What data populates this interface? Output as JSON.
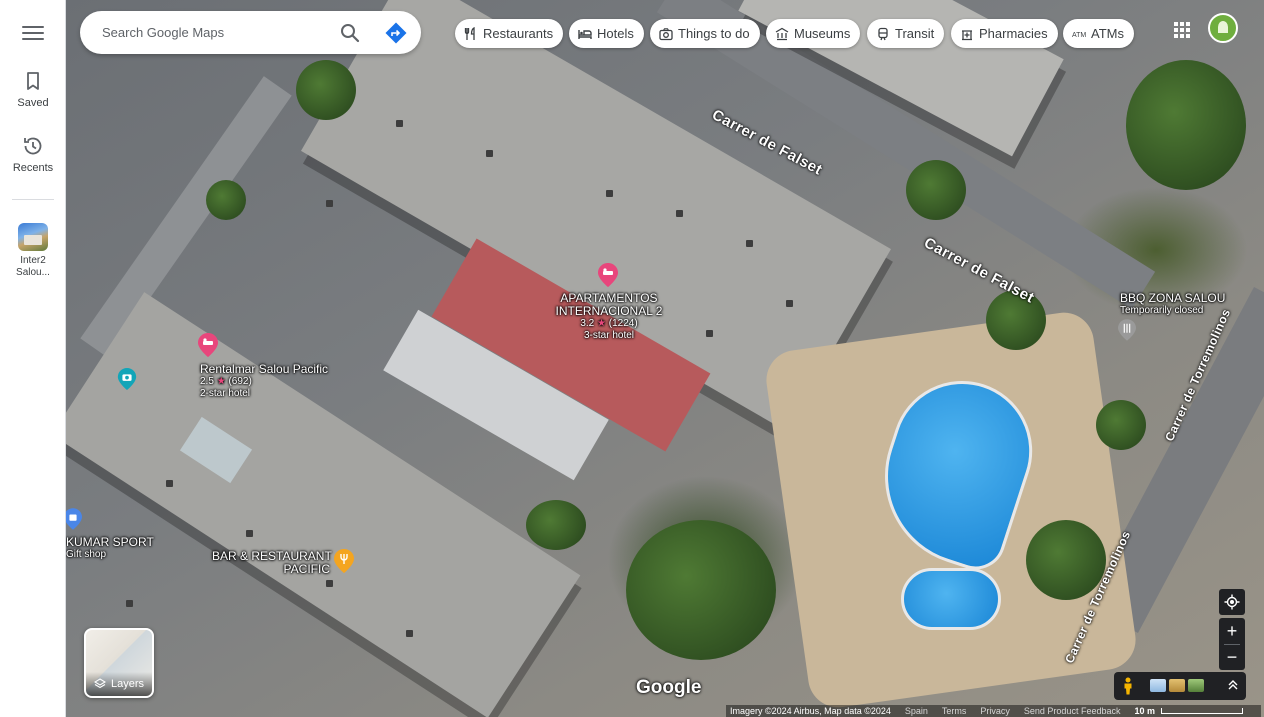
{
  "rail": {
    "saved_label": "Saved",
    "recents_label": "Recents",
    "recent_item": [
      "Inter2",
      "Salou..."
    ]
  },
  "search": {
    "placeholder": "Search Google Maps"
  },
  "chips": [
    {
      "label": "Restaurants",
      "icon": "fork-knife-icon"
    },
    {
      "label": "Hotels",
      "icon": "bed-icon"
    },
    {
      "label": "Things to do",
      "icon": "camera-icon"
    },
    {
      "label": "Museums",
      "icon": "museum-icon"
    },
    {
      "label": "Transit",
      "icon": "train-icon"
    },
    {
      "label": "Pharmacies",
      "icon": "pharmacy-icon"
    },
    {
      "label": "ATMs",
      "icon": "atm-icon"
    }
  ],
  "streets": {
    "falset_1": "Carrer de Falset",
    "falset_2": "Carrer de Falset",
    "torremolinos_1": "Carrer de Torremolinos",
    "torremolinos_2": "Carrer de Torremolinos"
  },
  "places": {
    "apartamentos": {
      "name_line1": "APARTAMENTOS",
      "name_line2": "INTERNACIONAL 2",
      "rating": "3.2",
      "reviews": "(1224)",
      "category": "3-star hotel"
    },
    "rentalmar": {
      "name": "Rentalmar Salou Pacific",
      "rating": "2.5",
      "reviews": "(692)",
      "category": "2-star hotel"
    },
    "bbq": {
      "name": "BBQ ZONA SALOU",
      "status": "Temporarily closed"
    },
    "kumar": {
      "name": "KUMAR SPORT",
      "category": "Gift shop"
    },
    "bar": {
      "name_line1": "BAR & RESTAURANT",
      "name_line2": "PACIFIC"
    }
  },
  "layers_label": "Layers",
  "logo_text": "Google",
  "attribution": {
    "imagery": "Imagery ©2024 Airbus, Map data ©2024",
    "region": "Spain",
    "terms": "Terms",
    "privacy": "Privacy",
    "feedback": "Send Product Feedback",
    "scale": "10 m"
  },
  "colors": {
    "hotel_pin": "#e8467c",
    "food_pin": "#f4a520",
    "shop_pin": "#4a86e8",
    "attraction_pin": "#12a5b8"
  }
}
